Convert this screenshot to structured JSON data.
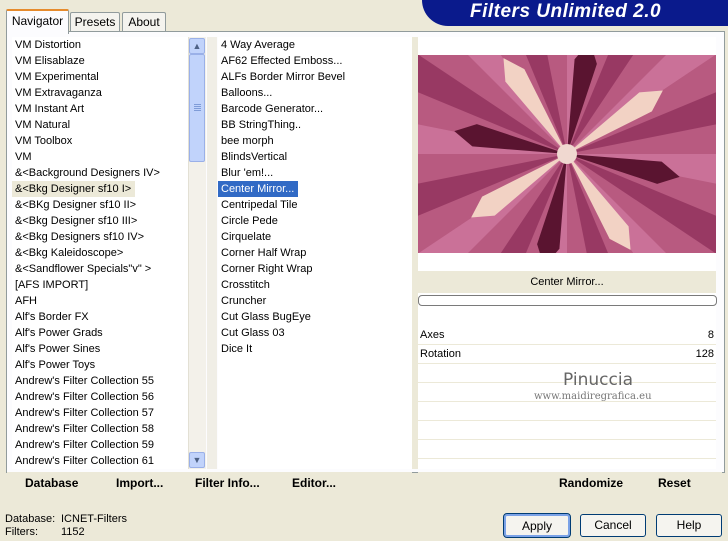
{
  "tabs": [
    {
      "label": "Navigator"
    },
    {
      "label": "Presets"
    },
    {
      "label": "About"
    }
  ],
  "banner": {
    "title": "Filters Unlimited 2.0"
  },
  "categories": [
    "VM Distortion",
    "VM Elisablaze",
    "VM Experimental",
    "VM Extravaganza",
    "VM Instant Art",
    "VM Natural",
    "VM Toolbox",
    "VM",
    "&<Background Designers IV>",
    "&<Bkg Designer sf10 I>",
    "&<BKg Designer sf10 II>",
    "&<Bkg Designer sf10 III>",
    "&<Bkg Designers sf10 IV>",
    "&<Bkg Kaleidoscope>",
    "&<Sandflower Specials\"v\" >",
    "[AFS IMPORT]",
    "AFH",
    "Alf's Border FX",
    "Alf's Power Grads",
    "Alf's Power Sines",
    "Alf's Power Toys",
    "Andrew's Filter Collection 55",
    "Andrew's Filter Collection 56",
    "Andrew's Filter Collection 57",
    "Andrew's Filter Collection 58",
    "Andrew's Filter Collection 59",
    "Andrew's Filter Collection 61"
  ],
  "selected_category": "&<Bkg Designer sf10 I>",
  "filters": [
    "4 Way Average",
    "AF62 Effected Emboss...",
    "ALFs Border Mirror Bevel",
    "Balloons...",
    "Barcode Generator...",
    "BB StringThing..",
    "bee morph",
    "BlindsVertical",
    "Blur 'em!...",
    "Center Mirror...",
    "Centripedal Tile",
    "Circle Pede",
    "Cirquelate",
    "Corner Half Wrap",
    "Corner Right Wrap",
    "Crosstitch",
    "Cruncher",
    "Cut Glass  BugEye",
    "Cut Glass 03",
    "Dice It"
  ],
  "selected_filter": "Center Mirror...",
  "scrollbar": {
    "up_icon": "arrow-up",
    "down_icon": "arrow-down"
  },
  "preview": {
    "filter_name": "Center Mirror...",
    "progress": 0
  },
  "params": [
    {
      "label": "Axes",
      "value": "8"
    },
    {
      "label": "Rotation",
      "value": "128"
    }
  ],
  "watermark": {
    "line1": "Pinuccia",
    "line2": "www.maidiregrafica.eu"
  },
  "toolbar": {
    "database": "Database",
    "import": "Import...",
    "filter_info": "Filter Info...",
    "editor": "Editor...",
    "randomize": "Randomize",
    "reset": "Reset"
  },
  "status": {
    "database_label": "Database:",
    "database_value": "ICNET-Filters",
    "filters_label": "Filters:",
    "filters_value": "1152"
  },
  "buttons": {
    "apply": "Apply",
    "cancel": "Cancel",
    "help": "Help"
  }
}
